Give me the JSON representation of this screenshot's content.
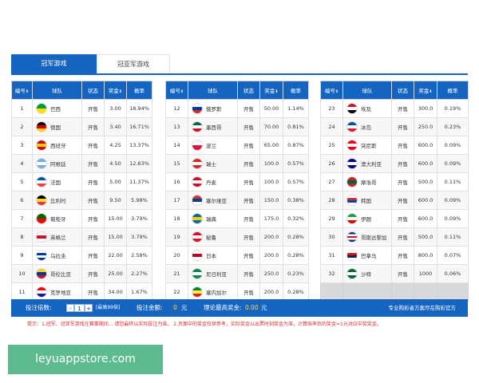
{
  "tabs": [
    {
      "label": "冠军游戏",
      "active": true
    },
    {
      "label": "冠亚军游戏",
      "active": false
    }
  ],
  "columns": [
    "编号",
    "球队",
    "状态",
    "奖金",
    "概率"
  ],
  "sort_arrow": "⬇",
  "tables": [
    [
      {
        "id": "1",
        "team": "巴西",
        "flag": [
          "#009c3b",
          "#ffdf00"
        ],
        "status": "开售",
        "odds": "3.00",
        "prob": "18.94%"
      },
      {
        "id": "2",
        "team": "德国",
        "flag": [
          "#000000",
          "#dd0000",
          "#ffce00"
        ],
        "status": "开售",
        "odds": "3.40",
        "prob": "16.71%"
      },
      {
        "id": "3",
        "team": "西班牙",
        "flag": [
          "#c60b1e",
          "#ffc400",
          "#c60b1e"
        ],
        "status": "开售",
        "odds": "4.25",
        "prob": "13.37%"
      },
      {
        "id": "4",
        "team": "阿根廷",
        "flag": [
          "#74acdf",
          "#ffffff",
          "#74acdf"
        ],
        "status": "开售",
        "odds": "4.50",
        "prob": "12.63%"
      },
      {
        "id": "5",
        "team": "法国",
        "flag": [
          "#0055a4",
          "#ffffff",
          "#ef4135"
        ],
        "status": "开售",
        "odds": "5.00",
        "prob": "11.37%"
      },
      {
        "id": "6",
        "team": "比利时",
        "flag": [
          "#000000",
          "#fdda24",
          "#ef3340"
        ],
        "status": "开售",
        "odds": "9.50",
        "prob": "5.98%"
      },
      {
        "id": "7",
        "team": "葡萄牙",
        "flag": [
          "#006600",
          "#ff0000"
        ],
        "status": "开售",
        "odds": "15.00",
        "prob": "3.79%"
      },
      {
        "id": "8",
        "team": "英格兰",
        "flag": [
          "#ffffff",
          "#ce1124",
          "#ffffff"
        ],
        "status": "开售",
        "odds": "15.00",
        "prob": "3.79%"
      },
      {
        "id": "9",
        "team": "乌拉圭",
        "flag": [
          "#ffffff",
          "#0038a8",
          "#ffffff",
          "#0038a8"
        ],
        "status": "开售",
        "odds": "22.00",
        "prob": "2.58%"
      },
      {
        "id": "10",
        "team": "哥伦比亚",
        "flag": [
          "#fcd116",
          "#003893",
          "#ce1126"
        ],
        "status": "开售",
        "odds": "25.00",
        "prob": "2.27%"
      },
      {
        "id": "11",
        "team": "克罗地亚",
        "flag": [
          "#ff0000",
          "#ffffff",
          "#171796"
        ],
        "status": "开售",
        "odds": "34.00",
        "prob": "1.67%"
      }
    ],
    [
      {
        "id": "12",
        "team": "俄罗斯",
        "flag": [
          "#ffffff",
          "#0039a6",
          "#d52b1e"
        ],
        "status": "开售",
        "odds": "50.00",
        "prob": "1.14%"
      },
      {
        "id": "13",
        "team": "墨西哥",
        "flag": [
          "#006847",
          "#ffffff",
          "#ce1126"
        ],
        "status": "开售",
        "odds": "70.00",
        "prob": "0.81%"
      },
      {
        "id": "14",
        "team": "波兰",
        "flag": [
          "#ffffff",
          "#dc143c"
        ],
        "status": "开售",
        "odds": "65.00",
        "prob": "0.87%"
      },
      {
        "id": "15",
        "team": "瑞士",
        "flag": [
          "#d52b1e",
          "#ffffff",
          "#d52b1e"
        ],
        "status": "开售",
        "odds": "100.0",
        "prob": "0.57%"
      },
      {
        "id": "16",
        "team": "丹麦",
        "flag": [
          "#c8102e",
          "#ffffff",
          "#c8102e"
        ],
        "status": "开售",
        "odds": "100.0",
        "prob": "0.57%"
      },
      {
        "id": "17",
        "team": "塞尔维亚",
        "flag": [
          "#c6363c",
          "#0c4076",
          "#ffffff"
        ],
        "status": "开售",
        "odds": "150.0",
        "prob": "0.38%"
      },
      {
        "id": "18",
        "team": "瑞典",
        "flag": [
          "#006aa7",
          "#fecc00",
          "#006aa7"
        ],
        "status": "开售",
        "odds": "175.0",
        "prob": "0.32%"
      },
      {
        "id": "19",
        "team": "秘鲁",
        "flag": [
          "#d91023",
          "#ffffff",
          "#d91023"
        ],
        "status": "开售",
        "odds": "200.0",
        "prob": "0.28%"
      },
      {
        "id": "20",
        "team": "日本",
        "flag": [
          "#ffffff",
          "#bc002d",
          "#ffffff"
        ],
        "status": "开售",
        "odds": "200.0",
        "prob": "0.28%"
      },
      {
        "id": "21",
        "team": "尼日利亚",
        "flag": [
          "#008751",
          "#ffffff",
          "#008751"
        ],
        "status": "开售",
        "odds": "250.0",
        "prob": "0.23%"
      },
      {
        "id": "22",
        "team": "塞内加尔",
        "flag": [
          "#00853f",
          "#fdef42",
          "#e31b23"
        ],
        "status": "开售",
        "odds": "200.0",
        "prob": "0.28%"
      }
    ],
    [
      {
        "id": "23",
        "team": "埃及",
        "flag": [
          "#ce1126",
          "#ffffff",
          "#000000"
        ],
        "status": "开售",
        "odds": "300.0",
        "prob": "0.19%"
      },
      {
        "id": "24",
        "team": "冰岛",
        "flag": [
          "#02529c",
          "#ffffff",
          "#dc1e35"
        ],
        "status": "开售",
        "odds": "250.0",
        "prob": "0.23%"
      },
      {
        "id": "25",
        "team": "突尼斯",
        "flag": [
          "#e70013",
          "#ffffff",
          "#e70013"
        ],
        "status": "开售",
        "odds": "600.0",
        "prob": "0.09%"
      },
      {
        "id": "26",
        "team": "澳大利亚",
        "flag": [
          "#00008b",
          "#ffffff",
          "#00008b"
        ],
        "status": "开售",
        "odds": "600.0",
        "prob": "0.09%"
      },
      {
        "id": "27",
        "team": "摩洛哥",
        "flag": [
          "#c1272d",
          "#006233",
          "#c1272d"
        ],
        "status": "开售",
        "odds": "500.0",
        "prob": "0.11%"
      },
      {
        "id": "28",
        "team": "韩国",
        "flag": [
          "#ffffff",
          "#cd2e3a",
          "#0047a0",
          "#ffffff"
        ],
        "status": "开售",
        "odds": "600.0",
        "prob": "0.09%"
      },
      {
        "id": "29",
        "team": "伊朗",
        "flag": [
          "#239f40",
          "#ffffff",
          "#da0000"
        ],
        "status": "开售",
        "odds": "600.0",
        "prob": "0.09%"
      },
      {
        "id": "30",
        "team": "哥斯达黎加",
        "flag": [
          "#002b7f",
          "#ffffff",
          "#ce1126",
          "#ffffff",
          "#002b7f"
        ],
        "status": "开售",
        "odds": "500.0",
        "prob": "0.11%"
      },
      {
        "id": "31",
        "team": "巴拿马",
        "flag": [
          "#ffffff",
          "#da121a",
          "#072357",
          "#ffffff"
        ],
        "status": "开售",
        "odds": "800.0",
        "prob": "0.07%"
      },
      {
        "id": "32",
        "team": "沙特",
        "flag": [
          "#006c35",
          "#ffffff",
          "#006c35"
        ],
        "status": "开售",
        "odds": "1000",
        "prob": "0.06%"
      }
    ]
  ],
  "footer": {
    "bet_count_label": "投注倍数:",
    "stepper_minus": "-",
    "stepper_value": "1",
    "stepper_plus": "+",
    "max_note": "[最高99倍]",
    "bet_amount_label": "投注金额:",
    "bet_amount_value": "0",
    "currency_unit": "元",
    "max_prize_label": "理论最高奖金:",
    "max_prize_value": "0.00",
    "max_prize_unit": "元",
    "slogan": "专业购彩者方案尽在购彩官方"
  },
  "note_text": "提示：1.冠军、冠亚军游戏在赛事期间...  请您最终以实际投注为准。  2.页面中的奖金仅供参考，实际奖金以出票时刻奖金为准，计算赔率后的奖金=1元对应中奖奖金。",
  "banner_text": "leyuappstore.com",
  "colors": {
    "primary": "#1565c0",
    "highlight": "#ffd54f",
    "banner": "#5dbb8f",
    "note": "#d32f2f"
  }
}
